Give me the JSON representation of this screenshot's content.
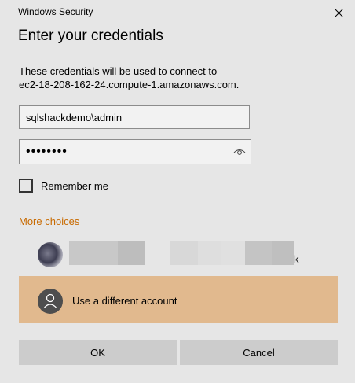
{
  "window": {
    "title": "Windows Security"
  },
  "dialog": {
    "heading": "Enter your credentials",
    "description_line1": "These credentials will be used to connect to",
    "description_line2": "ec2-18-208-162-24.compute-1.amazonaws.com."
  },
  "username": {
    "value": "sqlshackdemo\\admin"
  },
  "password": {
    "value": "••••••••"
  },
  "remember": {
    "label": "Remember me",
    "checked": false
  },
  "more_choices": {
    "label": "More choices"
  },
  "accounts": [
    {
      "name_visible_tail": "k",
      "icon": "user-photo-avatar"
    }
  ],
  "different_account": {
    "label": "Use a different account",
    "icon": "person-icon"
  },
  "buttons": {
    "ok_label": "OK",
    "cancel_label": "Cancel"
  },
  "colors": {
    "background": "#e6e6e6",
    "accent_link": "#c86a00",
    "selected_row": "#e1b98e",
    "button": "#cccccc"
  }
}
